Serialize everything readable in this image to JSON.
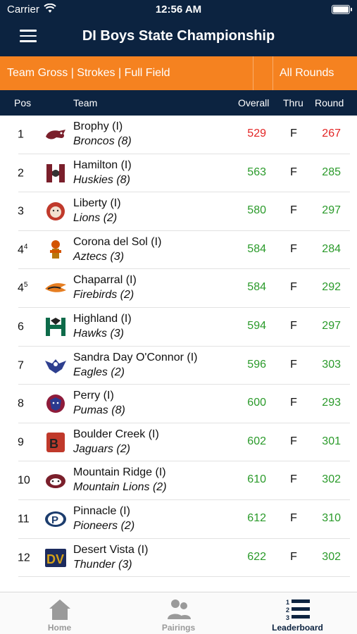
{
  "status_bar": {
    "carrier": "Carrier",
    "time": "12:56 AM"
  },
  "header": {
    "title": "DI Boys State Championship"
  },
  "filters": {
    "view": "Team Gross | Strokes | Full Field",
    "rounds": "All Rounds"
  },
  "columns": {
    "pos": "Pos",
    "team": "Team",
    "overall": "Overall",
    "thru": "Thru",
    "round": "Round"
  },
  "teams": [
    {
      "pos": "1",
      "pos_sup": "",
      "name": "Brophy (I)",
      "mascot": "Broncos (8)",
      "overall": "529",
      "thru": "F",
      "round": "267",
      "overall_color": "red",
      "round_color": "red",
      "logo": "bronco-logo"
    },
    {
      "pos": "2",
      "pos_sup": "",
      "name": "Hamilton (I)",
      "mascot": "Huskies (8)",
      "overall": "563",
      "thru": "F",
      "round": "285",
      "overall_color": "green",
      "round_color": "green",
      "logo": "husky-logo"
    },
    {
      "pos": "3",
      "pos_sup": "",
      "name": "Liberty (I)",
      "mascot": "Lions (2)",
      "overall": "580",
      "thru": "F",
      "round": "297",
      "overall_color": "green",
      "round_color": "green",
      "logo": "lion-logo"
    },
    {
      "pos": "4",
      "pos_sup": "4",
      "name": "Corona del Sol (I)",
      "mascot": "Aztecs (3)",
      "overall": "584",
      "thru": "F",
      "round": "284",
      "overall_color": "green",
      "round_color": "green",
      "logo": "aztec-logo"
    },
    {
      "pos": "4",
      "pos_sup": "5",
      "name": "Chaparral (I)",
      "mascot": "Firebirds (2)",
      "overall": "584",
      "thru": "F",
      "round": "292",
      "overall_color": "green",
      "round_color": "green",
      "logo": "firebird-logo"
    },
    {
      "pos": "6",
      "pos_sup": "",
      "name": "Highland (I)",
      "mascot": "Hawks (3)",
      "overall": "594",
      "thru": "F",
      "round": "297",
      "overall_color": "green",
      "round_color": "green",
      "logo": "hawk-logo"
    },
    {
      "pos": "7",
      "pos_sup": "",
      "name": "Sandra Day O'Connor (I)",
      "mascot": "Eagles (2)",
      "overall": "596",
      "thru": "F",
      "round": "303",
      "overall_color": "green",
      "round_color": "green",
      "logo": "eagle-logo"
    },
    {
      "pos": "8",
      "pos_sup": "",
      "name": "Perry (I)",
      "mascot": "Pumas (8)",
      "overall": "600",
      "thru": "F",
      "round": "293",
      "overall_color": "green",
      "round_color": "green",
      "logo": "puma-logo"
    },
    {
      "pos": "9",
      "pos_sup": "",
      "name": "Boulder Creek (I)",
      "mascot": "Jaguars (2)",
      "overall": "602",
      "thru": "F",
      "round": "301",
      "overall_color": "green",
      "round_color": "green",
      "logo": "jaguar-logo"
    },
    {
      "pos": "10",
      "pos_sup": "",
      "name": "Mountain Ridge (I)",
      "mascot": "Mountain Lions (2)",
      "overall": "610",
      "thru": "F",
      "round": "302",
      "overall_color": "green",
      "round_color": "green",
      "logo": "mountain-lion-logo"
    },
    {
      "pos": "11",
      "pos_sup": "",
      "name": "Pinnacle (I)",
      "mascot": "Pioneers (2)",
      "overall": "612",
      "thru": "F",
      "round": "310",
      "overall_color": "green",
      "round_color": "green",
      "logo": "pioneer-logo"
    },
    {
      "pos": "12",
      "pos_sup": "",
      "name": "Desert Vista (I)",
      "mascot": "Thunder (3)",
      "overall": "622",
      "thru": "F",
      "round": "302",
      "overall_color": "green",
      "round_color": "green",
      "logo": "thunder-logo"
    }
  ],
  "tabs": [
    {
      "label": "Home",
      "icon": "home-icon",
      "active": false
    },
    {
      "label": "Pairings",
      "icon": "pairings-icon",
      "active": false
    },
    {
      "label": "Leaderboard",
      "icon": "leaderboard-icon",
      "active": true
    }
  ],
  "colors": {
    "navy": "#0c2340",
    "orange": "#f58220",
    "leader_red": "#e32525",
    "score_green": "#2a9a2a"
  }
}
